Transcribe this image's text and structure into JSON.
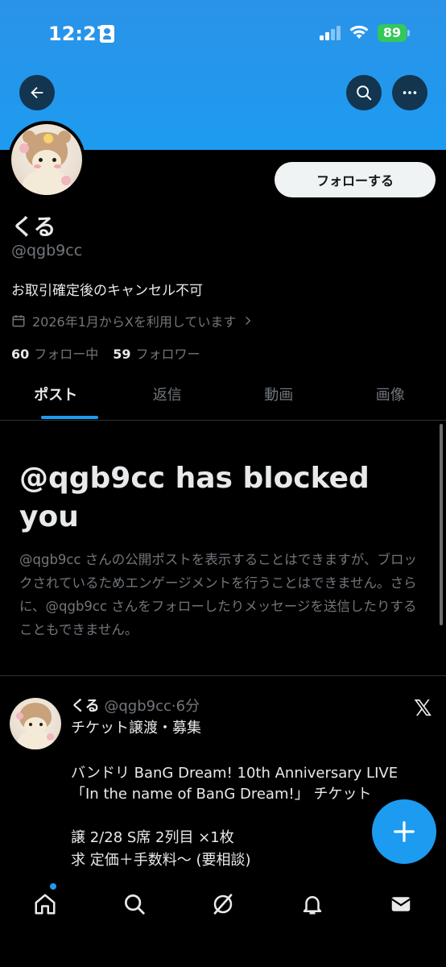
{
  "status_bar": {
    "time": "12:27",
    "battery": "89"
  },
  "header": {
    "back_icon": "arrow-left-icon",
    "search_icon": "search-icon",
    "more_icon": "more-horizontal-icon",
    "banner_color": "#1d9bf0"
  },
  "profile": {
    "display_name": "くる",
    "handle": "@qgb9cc",
    "bio": "お取引確定後のキャンセル不可",
    "joined": "2026年1月からXを利用しています",
    "following_count": "60",
    "following_label": "フォロー中",
    "followers_count": "59",
    "followers_label": "フォロワー",
    "follow_button": "フォローする"
  },
  "tabs": [
    {
      "label": "ポスト",
      "active": true
    },
    {
      "label": "返信",
      "active": false
    },
    {
      "label": "動画",
      "active": false
    },
    {
      "label": "画像",
      "active": false
    }
  ],
  "blocked": {
    "title": "@qgb9cc has blocked you",
    "description": "@qgb9cc さんの公開ポストを表示することはできますが、ブロックされているためエンゲージメントを行うことはできません。さらに、@qgb9cc さんをフォローしたりメッセージを送信したりすることもできません。"
  },
  "post": {
    "name": "くる",
    "meta": "@qgb9cc·6分",
    "lines": [
      "チケット譲渡・募集",
      "",
      "バンドリ BanG Dream! 10th Anniversary  LIVE",
      "「In the name of BanG Dream!」 チケット",
      "",
      "譲 2/28 S席 2列目 ×1枚",
      "求 定価＋手数料〜 (要相談)"
    ],
    "x_logo": "𝕏"
  },
  "bottom_nav": {
    "items": [
      "home-icon",
      "search-icon",
      "grok-icon",
      "notifications-icon",
      "messages-icon"
    ]
  },
  "colors": {
    "accent": "#1d9bf0",
    "background": "#000000",
    "text": "#e7e9ea",
    "muted": "#71767b"
  }
}
